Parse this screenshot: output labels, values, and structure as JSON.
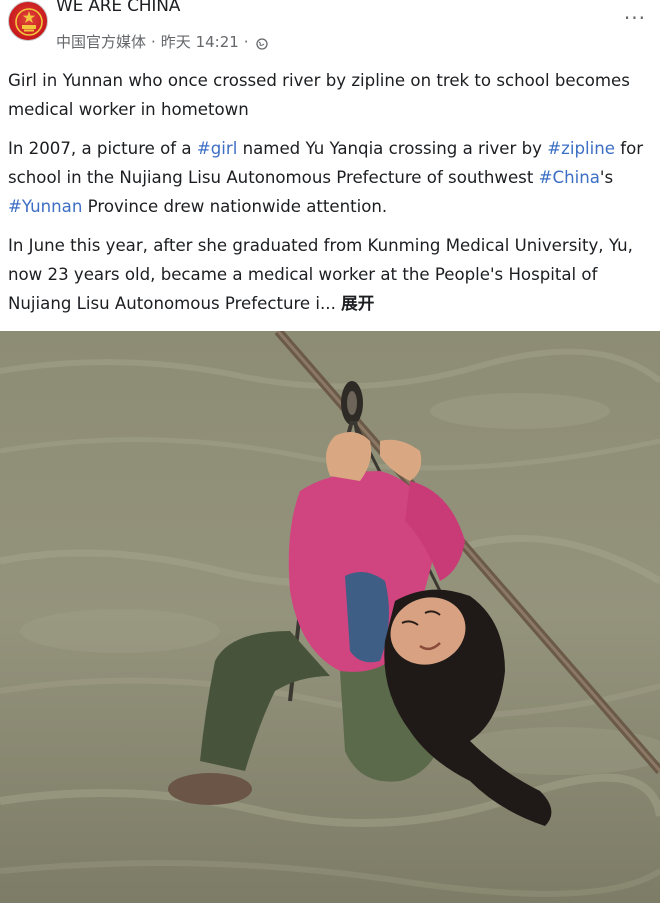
{
  "page": {
    "name": "WE ARE CHINA",
    "subtitle": "中国官方媒体",
    "time": "昨天 14:21",
    "separator": "·"
  },
  "post": {
    "headline": "Girl in Yunnan who once crossed river by zipline on trek to school becomes medical worker in hometown",
    "para2_a": "In 2007, a picture of a ",
    "para2_tag1": "#girl",
    "para2_b": " named Yu Yanqia crossing a river by ",
    "para2_tag2": "#zipline",
    "para2_c": " for school in the Nujiang Lisu Autonomous Prefecture of southwest ",
    "para2_tag3": "#China",
    "para2_d": "'s ",
    "para2_tag4": "#Yunnan",
    "para2_e": " Province drew nationwide attention.",
    "para3": "In June this year, after she graduated from Kunming Medical University, Yu, now 23 years old, became a medical worker at the People's Hospital of Nujiang Lisu Autonomous Prefecture i... ",
    "see_more": "展开"
  },
  "icons": {
    "more": "more-options-icon",
    "globe": "globe-icon"
  },
  "colors": {
    "hashtag": "#3d6fc4",
    "meta": "#65676b",
    "avatar": "#c8181c"
  }
}
